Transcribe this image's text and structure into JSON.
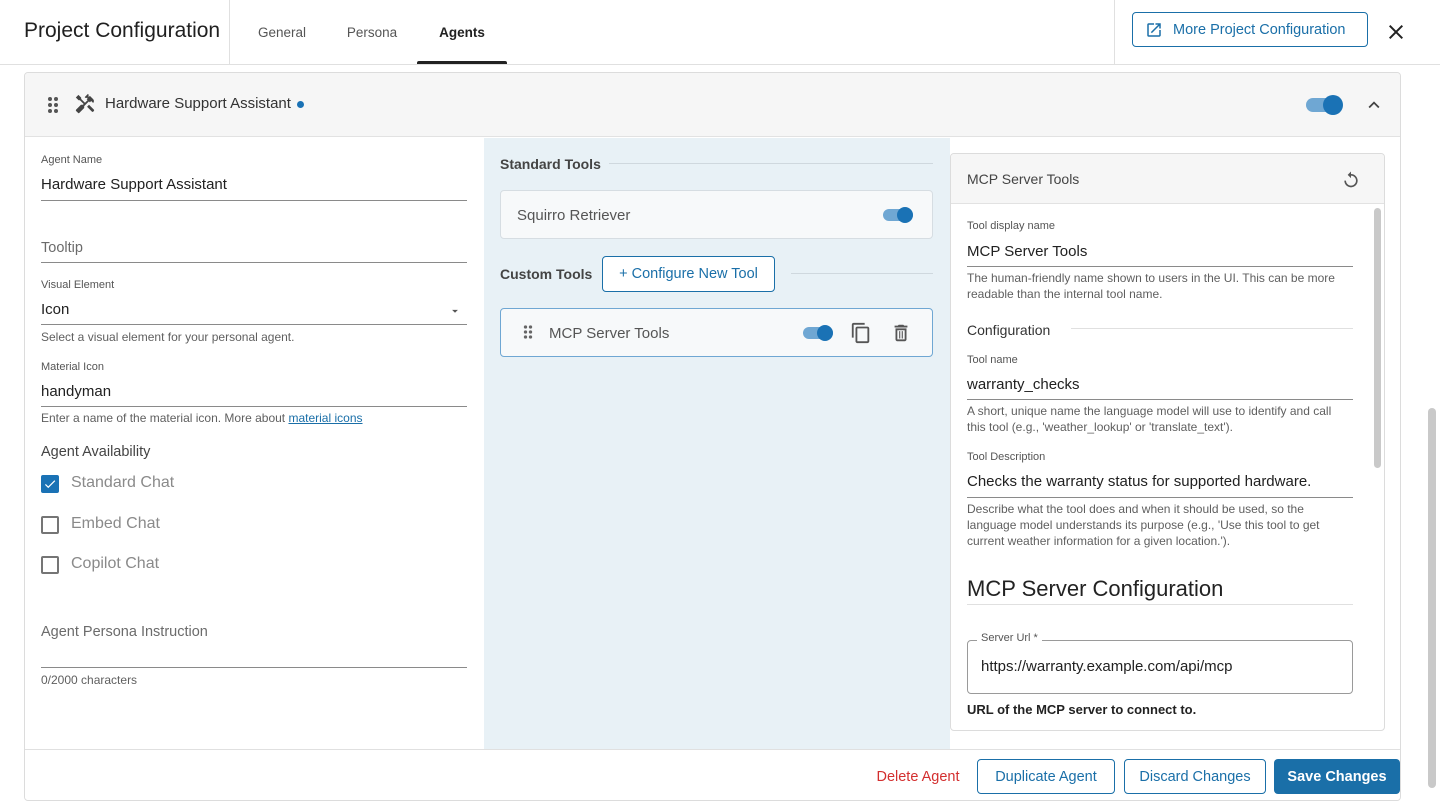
{
  "header": {
    "title": "Project Configuration",
    "tabs": [
      {
        "label": "General",
        "active": false
      },
      {
        "label": "Persona",
        "active": false
      },
      {
        "label": "Agents",
        "active": true
      }
    ],
    "more_button_label": "More Project Configuration",
    "close_icon": "close-icon"
  },
  "agent": {
    "title": "Hardware Support Assistant",
    "header_icon": "handyman-icon",
    "enabled": true,
    "unsaved_dot_color": "#1a72b5"
  },
  "form": {
    "agent_name": {
      "label": "Agent Name",
      "value": "Hardware Support Assistant"
    },
    "tooltip": {
      "placeholder": "Tooltip"
    },
    "visual_element": {
      "label": "Visual Element",
      "value": "Icon",
      "hint": "Select a visual element for your personal agent."
    },
    "material_icon": {
      "label": "Material Icon",
      "value": "handyman",
      "hint_prefix": "Enter a name of the material icon. More about ",
      "hint_link": "material icons"
    },
    "availability": {
      "label": "Agent Availability",
      "options": [
        {
          "label": "Standard Chat",
          "checked": true
        },
        {
          "label": "Embed Chat",
          "checked": false
        },
        {
          "label": "Copilot Chat",
          "checked": false
        }
      ]
    },
    "persona_instruction": {
      "placeholder": "Agent Persona Instruction",
      "counter": "0/2000 characters"
    }
  },
  "tools": {
    "standard_heading": "Standard Tools",
    "standard": [
      {
        "name": "Squirro Retriever",
        "enabled": true
      }
    ],
    "custom_heading": "Custom Tools",
    "configure_button": "+ Configure New Tool",
    "custom": [
      {
        "name": "MCP Server Tools",
        "enabled": true
      }
    ]
  },
  "detail": {
    "title": "MCP Server Tools",
    "display_name": {
      "label": "Tool display name",
      "value": "MCP Server Tools",
      "hint": "The human-friendly name shown to users in the UI. This can be more readable than the internal tool name."
    },
    "configuration_heading": "Configuration",
    "tool_name": {
      "label": "Tool name",
      "value": "warranty_checks",
      "hint": "A short, unique name the language model will use to identify and call this tool (e.g., 'weather_lookup' or 'translate_text')."
    },
    "tool_description": {
      "label": "Tool Description",
      "value": "Checks the warranty status for supported hardware.",
      "hint": "Describe what the tool does and when it should be used, so the language model understands its purpose (e.g., 'Use this tool to get current weather information for a given location.')."
    },
    "mcp_heading": "MCP Server Configuration",
    "server_url": {
      "label": "Server Url *",
      "value": "https://warranty.example.com/api/mcp",
      "hint": "URL of the MCP server to connect to."
    }
  },
  "footer": {
    "delete": "Delete Agent",
    "duplicate": "Duplicate Agent",
    "discard": "Discard Changes",
    "save": "Save Changes"
  },
  "colors": {
    "accent": "#1a6fa8",
    "danger": "#d32f2f",
    "panel_bg": "#e8f1f6"
  }
}
